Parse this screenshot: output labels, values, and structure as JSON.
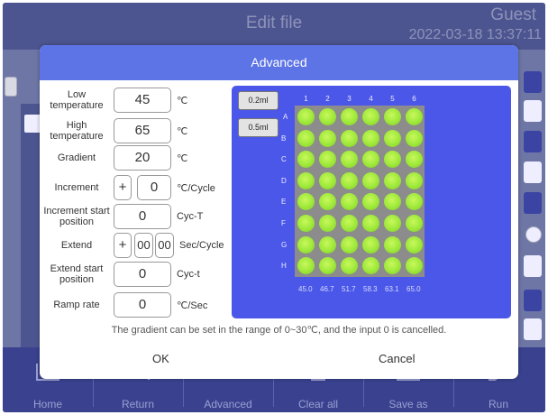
{
  "app": {
    "title": "Edit file",
    "user": "Guest",
    "datetime": "2022-03-18 13:37:11"
  },
  "toolbar": {
    "items": [
      {
        "label": "Home",
        "icon": "home-icon"
      },
      {
        "label": "Return",
        "icon": "return-icon"
      },
      {
        "label": "Advanced",
        "icon": "gear-icon"
      },
      {
        "label": "Clear all",
        "icon": "trash-icon"
      },
      {
        "label": "Save as",
        "icon": "save-icon"
      },
      {
        "label": "Run",
        "icon": "run-icon"
      }
    ]
  },
  "modal": {
    "title": "Advanced",
    "low_temperature": {
      "label": "Low temperature",
      "value": "45",
      "unit": "℃"
    },
    "high_temperature": {
      "label": "High temperature",
      "value": "65",
      "unit": "℃"
    },
    "gradient": {
      "label": "Gradient",
      "value": "20",
      "unit": "℃"
    },
    "increment": {
      "label": "Increment",
      "sign": "+",
      "value": "0",
      "unit": "℃/Cycle"
    },
    "increment_start": {
      "label": "Increment start position",
      "value": "0",
      "unit": "Cyc-T"
    },
    "extend": {
      "label": "Extend",
      "sign": "+",
      "minutes": "00",
      "seconds": "00",
      "unit": "Sec/Cycle"
    },
    "extend_start": {
      "label": "Extend start position",
      "value": "0",
      "unit": "Cyc-t"
    },
    "ramp_rate": {
      "label": "Ramp rate",
      "value": "0",
      "unit": "℃/Sec"
    },
    "hint": "The gradient can be set in the range of 0~30℃, and the input 0 is cancelled.",
    "ok_label": "OK",
    "cancel_label": "Cancel"
  },
  "plate": {
    "volume_buttons": [
      "0.2ml",
      "0.5ml"
    ],
    "columns": [
      "1",
      "2",
      "3",
      "4",
      "5",
      "6"
    ],
    "rows": [
      "A",
      "B",
      "C",
      "D",
      "E",
      "F",
      "G",
      "H"
    ],
    "column_temps": [
      "45.0",
      "46.7",
      "51.7",
      "58.3",
      "63.1",
      "65.0"
    ],
    "well_color": "#9ee83a",
    "plate_color": "#4b57e8"
  }
}
